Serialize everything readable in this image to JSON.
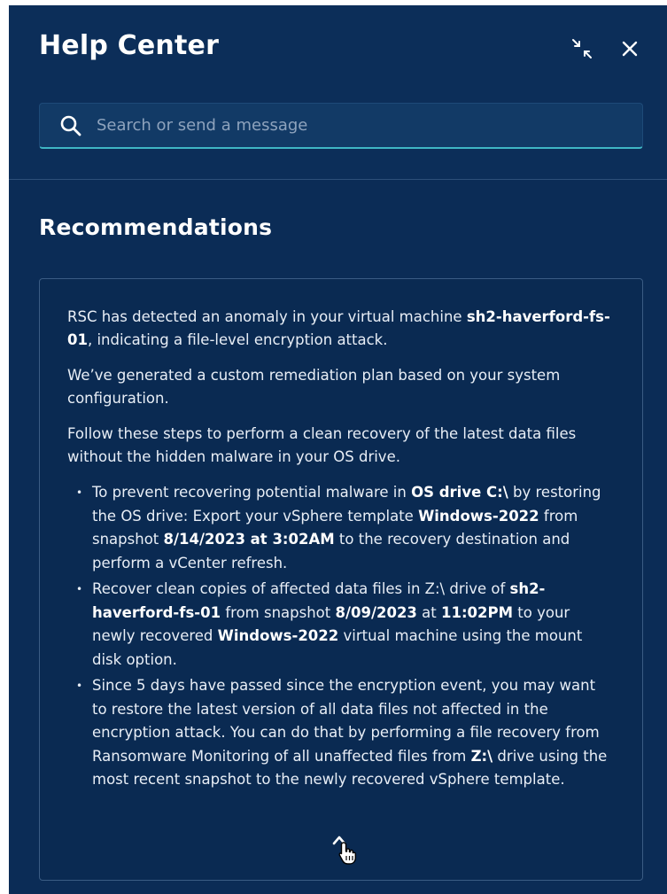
{
  "header": {
    "title": "Help Center",
    "collapse_icon": "collapse-arrows-icon",
    "close_icon": "close-icon"
  },
  "search": {
    "placeholder": "Search or send a message",
    "value": "",
    "icon": "search-icon"
  },
  "recommendations": {
    "title": "Recommendations",
    "p1": {
      "a": "RSC has detected an anomaly in your virtual machine ",
      "b": "sh2-haverford-fs-01",
      "c": ", indicating a file-level encryption attack."
    },
    "p2": "We’ve generated a custom remediation plan based on your system configuration.",
    "p3": "Follow these steps to perform a clean recovery of the latest data files without the hidden malware in your OS drive.",
    "bullet1": {
      "a": "To prevent recovering potential malware in ",
      "b": "OS drive C:\\",
      "c": " by restoring the OS drive: Export your vSphere template ",
      "d": "Windows-2022",
      "e": " from snapshot ",
      "f": "8/14/2023 at 3:02AM",
      "g": " to the recovery destination and perform a vCenter refresh."
    },
    "bullet2": {
      "a": "Recover clean copies of affected data files in Z:\\ drive of ",
      "b": "sh2-haverford-fs-01",
      "c": " from snapshot ",
      "d": "8/09/2023",
      "e": " at ",
      "f": "11:02PM",
      "g": " to your newly recovered ",
      "h": "Windows-2022",
      "i": " virtual machine using the mount disk option."
    },
    "bullet3": {
      "a": "Since 5 days have passed since the encryption event, you may want to restore the latest version of all data files not affected in the encryption attack. You can do that by performing a file recovery from Ransomware Monitoring of all unaffected files from ",
      "b": "Z:\\",
      "c": " drive using the most recent snapshot to the newly recovered vSphere template."
    },
    "collapse_icon": "chevron-up-icon"
  },
  "colors": {
    "panel_bg": "#0b2c56",
    "accent": "#3fb6c4",
    "text": "#ffffff"
  }
}
